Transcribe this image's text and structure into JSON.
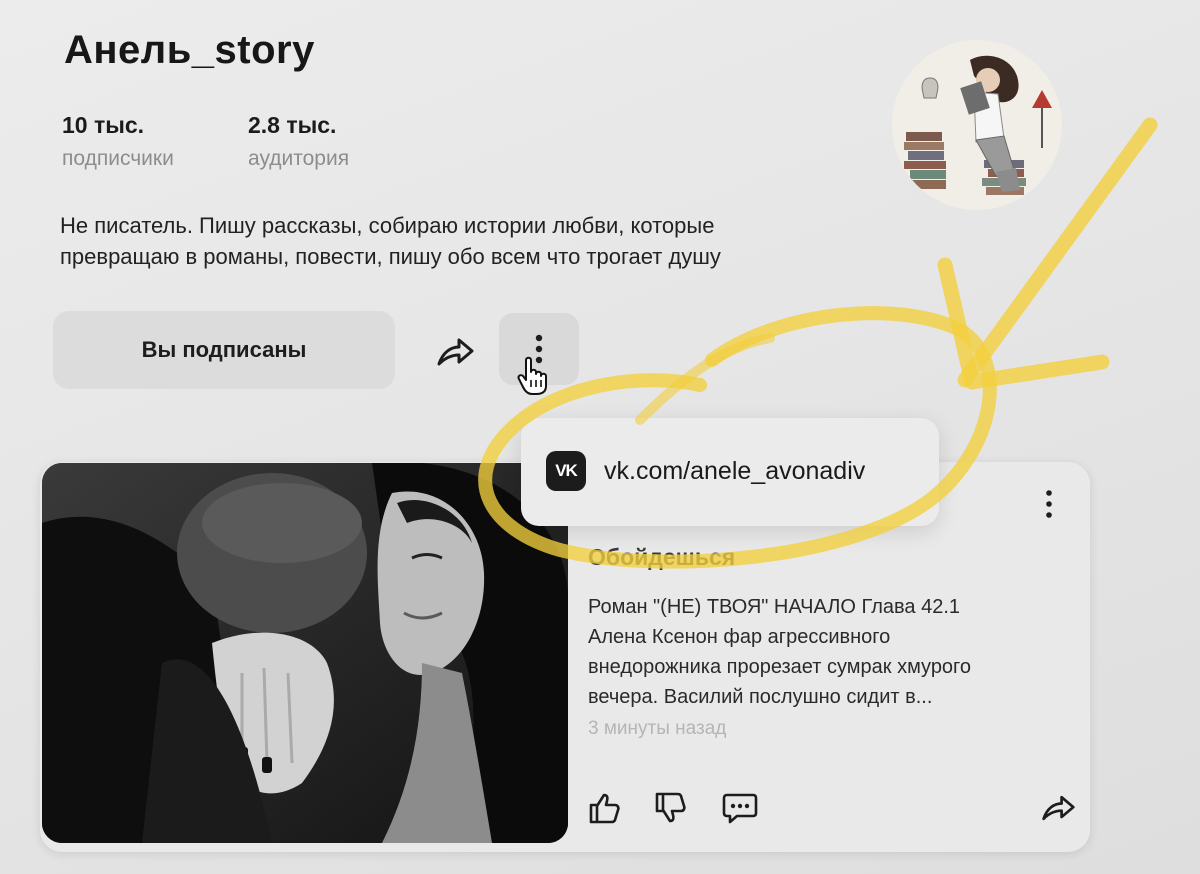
{
  "channel": {
    "name": "Анель_story",
    "stats": [
      {
        "value": "10 тыс.",
        "label": "подписчики"
      },
      {
        "value": "2.8 тыс.",
        "label": "аудитория"
      }
    ],
    "description_line1": "Не писатель. Пишу рассказы, собираю истории любви, которые",
    "description_line2": "превращаю в романы, повести, пишу обо всем что трогает душу",
    "subscribe_label": "Вы подписаны",
    "avatar_icon": "reading-woman-avatar"
  },
  "menu_popover": {
    "link_text": "vk.com/anele_avonadiv",
    "logo_text": "VK"
  },
  "post": {
    "title": "Обойдешься",
    "excerpt_line1": "Роман \"(НЕ) ТВОЯ\" НАЧАЛО Глава 42.1",
    "excerpt_line2": "Алена Ксенон фар агрессивного",
    "excerpt_line3": "внедорожника прорезает сумрак хмурого",
    "excerpt_line4": "вечера. Василий послушно сидит в...",
    "time": "3 минуты назад"
  },
  "colors": {
    "highlight": "#f2cf3d",
    "background": "#e8e8e8",
    "button_bg": "#dcdcdc"
  }
}
